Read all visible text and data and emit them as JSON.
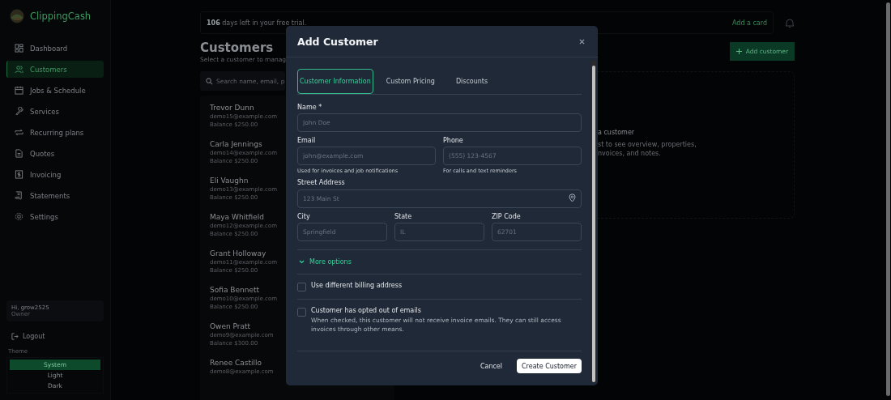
{
  "sidebar": {
    "brand": "ClippingCash",
    "items": [
      {
        "label": "Dashboard",
        "selected": false
      },
      {
        "label": "Customers",
        "selected": true
      },
      {
        "label": "Jobs & Schedule",
        "selected": false
      },
      {
        "label": "Services",
        "selected": false
      },
      {
        "label": "Recurring plans",
        "selected": false
      },
      {
        "label": "Quotes",
        "selected": false
      },
      {
        "label": "Invoicing",
        "selected": false
      },
      {
        "label": "Statements",
        "selected": false
      },
      {
        "label": "Settings",
        "selected": false
      }
    ],
    "user": {
      "greeting": "Hi, grow2525",
      "role": "Owner"
    },
    "logout": "Logout",
    "theme": {
      "label": "Theme",
      "options": [
        {
          "label": "System",
          "selected": true
        },
        {
          "label": "Light",
          "selected": false
        },
        {
          "label": "Dark",
          "selected": false
        }
      ]
    }
  },
  "trial_banner": {
    "text": "**106** days left in your free trial.",
    "action": "Add a card"
  },
  "page": {
    "title": "Customers",
    "subtitle": "Select a customer to manag",
    "add_button": "Add customer",
    "search": {
      "placeholder": "Search name, email, p"
    }
  },
  "customers": [
    {
      "name": "Trevor Dunn",
      "email": "demo15@example.com",
      "balance": "Balance $250.00"
    },
    {
      "name": "Carla Jennings",
      "email": "demo14@example.com",
      "balance": "Balance $250.00"
    },
    {
      "name": "Eli Vaughn",
      "email": "demo13@example.com",
      "balance": "Balance $250.00"
    },
    {
      "name": "Maya Whitfield",
      "email": "demo12@example.com",
      "balance": "Balance $250.00"
    },
    {
      "name": "Grant Holloway",
      "email": "demo11@example.com",
      "balance": "Balance $250.00"
    },
    {
      "name": "Sofia Bennett",
      "email": "demo10@example.com",
      "balance": "Balance $250.00"
    },
    {
      "name": "Owen Pratt",
      "email": "demo9@example.com",
      "balance": "Balance $300.00"
    },
    {
      "name": "Renee Castillo",
      "email": "demo8@example.com"
    }
  ],
  "empty_state": {
    "title": "a customer",
    "lines": [
      "st to see overview, properties,",
      "nvoices, and notes."
    ]
  },
  "dialog": {
    "title": "Add Customer",
    "tabs": [
      {
        "label": "Customer Information",
        "selected": true
      },
      {
        "label": "Custom Pricing",
        "selected": false
      },
      {
        "label": "Discounts",
        "selected": false
      }
    ],
    "name": {
      "label": "Name *",
      "placeholder": "John Doe"
    },
    "email": {
      "label": "Email",
      "placeholder": "john@example.com",
      "hint": "Used for invoices and job notifications"
    },
    "phone": {
      "label": "Phone",
      "placeholder": "(555) 123-4567",
      "hint": "For calls and text reminders"
    },
    "street": {
      "label": "Street Address",
      "placeholder": "123 Main St"
    },
    "city": {
      "label": "City",
      "placeholder": "Springfield"
    },
    "state": {
      "label": "State",
      "placeholder": "IL"
    },
    "zip": {
      "label": "ZIP Code",
      "placeholder": "62701"
    },
    "more_options": {
      "label": "More options",
      "expanded": false
    },
    "checkboxes": [
      {
        "label": "Use different billing address",
        "checked": false
      },
      {
        "label": "Customer has opted out of emails",
        "checked": false,
        "description": "When checked, this customer will not receive invoice emails. They can still access invoices through other means."
      }
    ],
    "cancel": "Cancel",
    "submit": "Create Customer"
  }
}
